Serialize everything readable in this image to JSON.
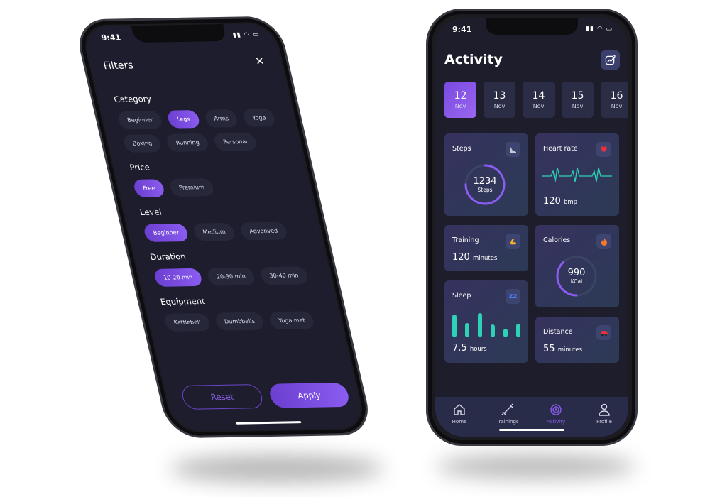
{
  "colors": {
    "accent": "#8a5cf0",
    "teal": "#2ed3b7",
    "screen_bg": "#1d1d2b",
    "card_bg": "#33345a"
  },
  "status_bar": {
    "time": "9:41"
  },
  "filters": {
    "title": "Filters",
    "close_icon": "close-icon",
    "sections": [
      {
        "title": "Category",
        "chips": [
          {
            "label": "Beginner",
            "selected": false
          },
          {
            "label": "Legs",
            "selected": true
          },
          {
            "label": "Arms",
            "selected": false
          },
          {
            "label": "Yoga",
            "selected": false
          },
          {
            "label": "Boxing",
            "selected": false
          },
          {
            "label": "Running",
            "selected": false
          },
          {
            "label": "Personal",
            "selected": false
          }
        ]
      },
      {
        "title": "Price",
        "chips": [
          {
            "label": "Free",
            "selected": true
          },
          {
            "label": "Premium",
            "selected": false
          }
        ]
      },
      {
        "title": "Level",
        "chips": [
          {
            "label": "Beginner",
            "selected": true
          },
          {
            "label": "Medium",
            "selected": false
          },
          {
            "label": "Advanved",
            "selected": false
          }
        ]
      },
      {
        "title": "Duration",
        "chips": [
          {
            "label": "10-20 min",
            "selected": true
          },
          {
            "label": "20-30 min",
            "selected": false
          },
          {
            "label": "30-40 min",
            "selected": false
          }
        ]
      },
      {
        "title": "Equipment",
        "chips": [
          {
            "label": "Kettlebell",
            "selected": false
          },
          {
            "label": "Dumbbells",
            "selected": false
          },
          {
            "label": "Yoga mat",
            "selected": false
          }
        ]
      }
    ],
    "reset_label": "Reset",
    "apply_label": "Apply"
  },
  "activity": {
    "title": "Activity",
    "dates": [
      {
        "day": "12",
        "month": "Nov",
        "selected": true
      },
      {
        "day": "13",
        "month": "Nov"
      },
      {
        "day": "14",
        "month": "Nov"
      },
      {
        "day": "15",
        "month": "Nov"
      },
      {
        "day": "16",
        "month": "Nov"
      }
    ],
    "steps": {
      "label": "Steps",
      "value": "1234",
      "unit": "Steps",
      "progress": 0.75
    },
    "heart_rate": {
      "label": "Heart rate",
      "value": "120",
      "unit": "bmp"
    },
    "training": {
      "label": "Training",
      "value": "120",
      "unit": "minutes"
    },
    "calories": {
      "label": "Calories",
      "value": "990",
      "unit": "KCal",
      "progress": 0.38
    },
    "sleep": {
      "label": "Sleep",
      "value": "7.5",
      "unit": "hours",
      "bars": [
        0.9,
        0.55,
        0.95,
        0.5,
        0.32,
        0.52
      ]
    },
    "distance": {
      "label": "Distance",
      "value": "55",
      "unit": "minutes"
    }
  },
  "nav": [
    {
      "label": "Home",
      "icon": "home-icon"
    },
    {
      "label": "Trainings",
      "icon": "dumbbell-icon"
    },
    {
      "label": "Activity",
      "icon": "target-icon",
      "active": true
    },
    {
      "label": "Profile",
      "icon": "profile-icon"
    }
  ]
}
